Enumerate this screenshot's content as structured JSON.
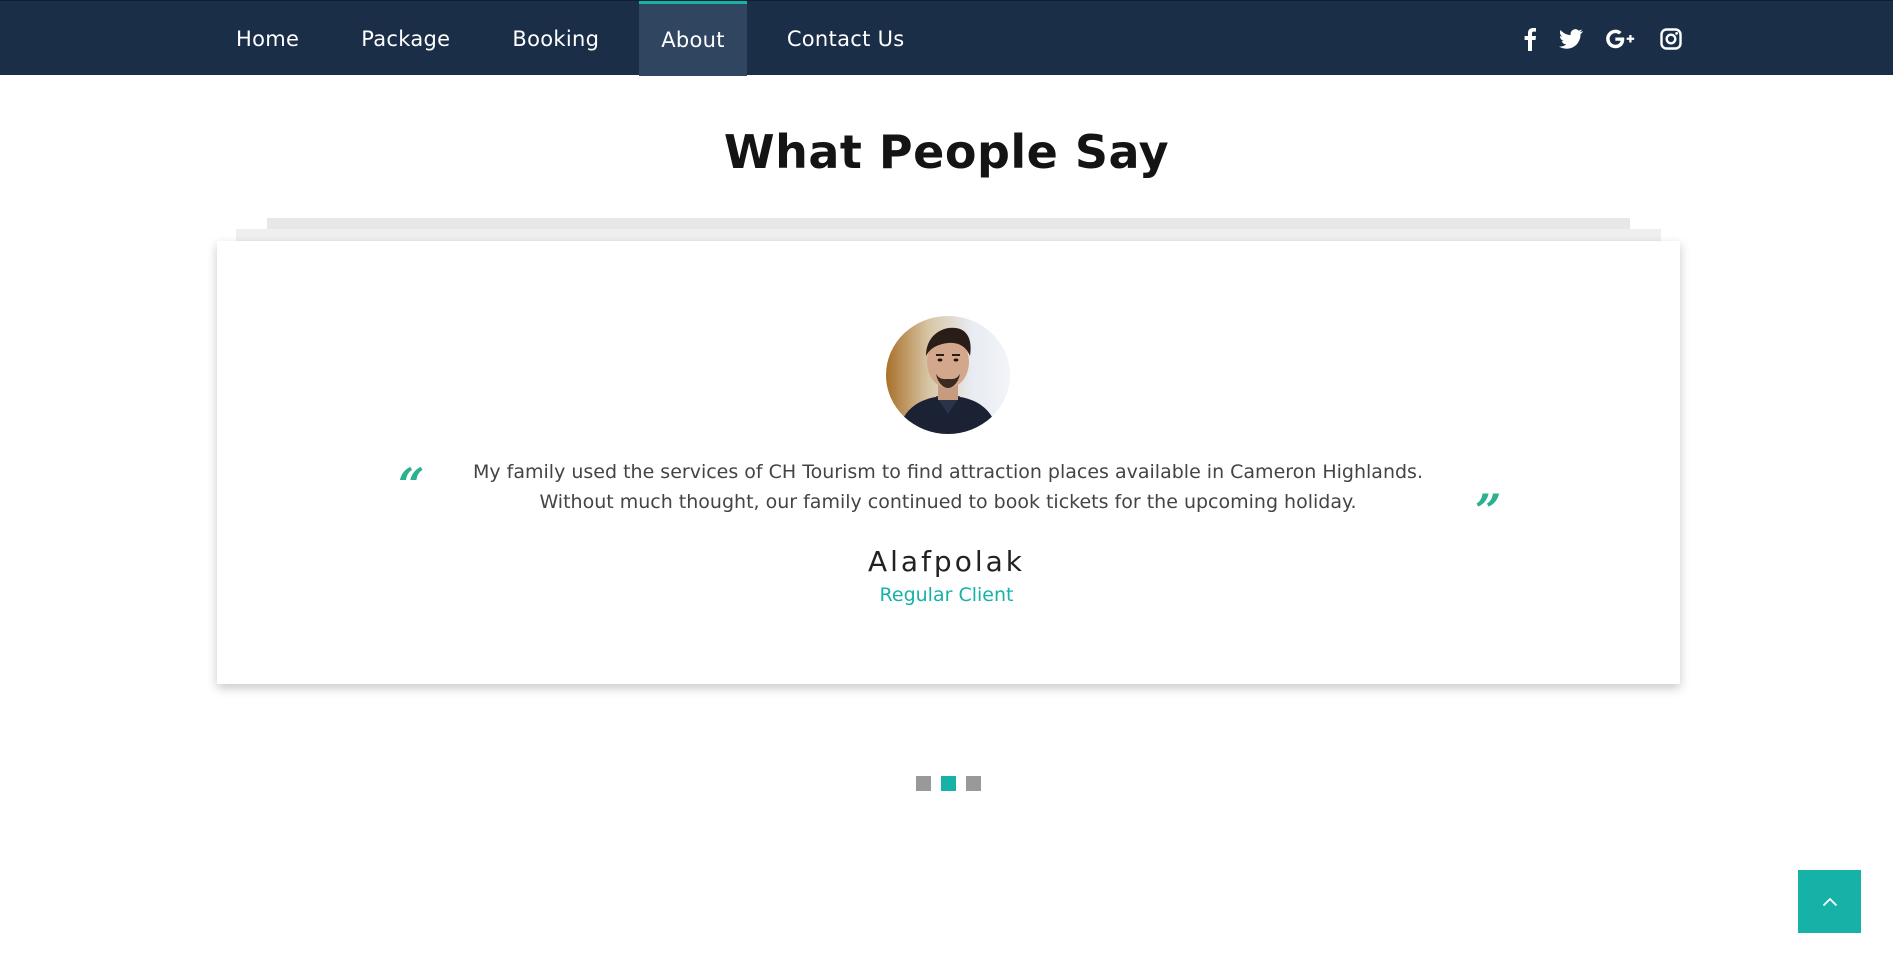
{
  "nav": {
    "items": [
      {
        "label": "Home",
        "active": false
      },
      {
        "label": "Package",
        "active": false
      },
      {
        "label": "Booking",
        "active": false
      },
      {
        "label": "About",
        "active": true
      },
      {
        "label": "Contact Us",
        "active": false
      }
    ],
    "social": [
      "facebook-icon",
      "twitter-icon",
      "google-plus-icon",
      "instagram-icon"
    ]
  },
  "section": {
    "title": "What People Say"
  },
  "testimonial": {
    "text": "My family used the services of CH Tourism to find attraction places available in Cameron Highlands. Without much thought, our family continued to book tickets for the upcoming holiday.",
    "name": "Alafpolak",
    "role": "Regular Client"
  },
  "slider": {
    "total": 3,
    "active_index": 1
  },
  "colors": {
    "nav_bg": "#1a2e47",
    "nav_active_bg": "#2f4560",
    "accent": "#16b2a7",
    "quote": "#2db08f",
    "dot_inactive": "#999999"
  },
  "back_to_top": {
    "icon": "chevron-up-icon"
  }
}
